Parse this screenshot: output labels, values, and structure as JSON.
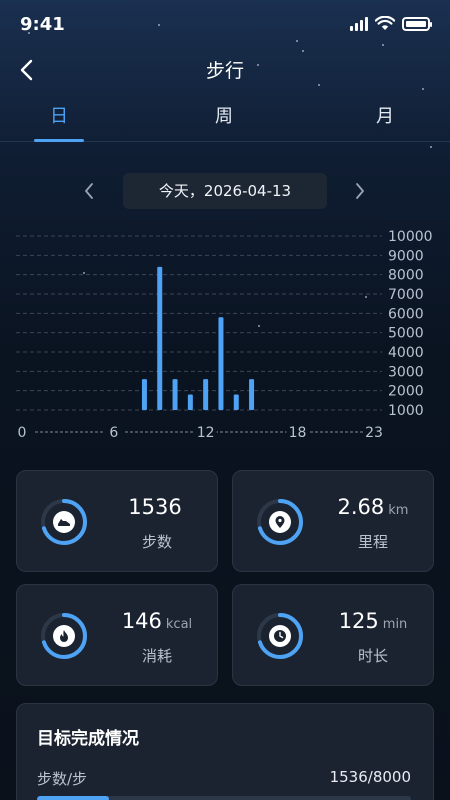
{
  "status_bar": {
    "time": "9:41"
  },
  "header": {
    "title": "步行"
  },
  "tabs": [
    {
      "label": "日",
      "active": true
    },
    {
      "label": "周",
      "active": false
    },
    {
      "label": "月",
      "active": false
    }
  ],
  "date_selector": {
    "label": "今天，2026-04-13"
  },
  "chart_data": {
    "type": "bar",
    "x_ticks": [
      "0",
      "6",
      "12",
      "18",
      "23"
    ],
    "x_range": [
      0,
      23
    ],
    "y_ticks": [
      "10000",
      "9000",
      "8000",
      "7000",
      "6000",
      "5000",
      "4000",
      "3000",
      "2000",
      "1000"
    ],
    "y_range": [
      1000,
      10000
    ],
    "bars": [
      {
        "hour": 8,
        "value": 2600
      },
      {
        "hour": 9,
        "value": 8400
      },
      {
        "hour": 10,
        "value": 2600
      },
      {
        "hour": 11,
        "value": 1800
      },
      {
        "hour": 12,
        "value": 2600
      },
      {
        "hour": 13,
        "value": 5800
      },
      {
        "hour": 14,
        "value": 1800
      },
      {
        "hour": 15,
        "value": 2600
      }
    ],
    "bar_color": "#4ea3f5",
    "grid": true
  },
  "stats": [
    {
      "id": "steps",
      "value": "1536",
      "unit": "",
      "label": "步数",
      "icon": "shoe-icon",
      "progress": 0.7
    },
    {
      "id": "distance",
      "value": "2.68",
      "unit": "km",
      "label": "里程",
      "icon": "location-pin-icon",
      "progress": 0.7
    },
    {
      "id": "calories",
      "value": "146",
      "unit": "kcal",
      "label": "消耗",
      "icon": "flame-icon",
      "progress": 0.7
    },
    {
      "id": "duration",
      "value": "125",
      "unit": "min",
      "label": "时长",
      "icon": "clock-icon",
      "progress": 0.7
    }
  ],
  "goal": {
    "title": "目标完成情况",
    "row_label": "步数/步",
    "row_value": "1536/8000",
    "current": 1536,
    "target": 8000
  },
  "colors": {
    "accent": "#4ea3f5",
    "card": "#1b2330",
    "background": "#0b1320"
  }
}
